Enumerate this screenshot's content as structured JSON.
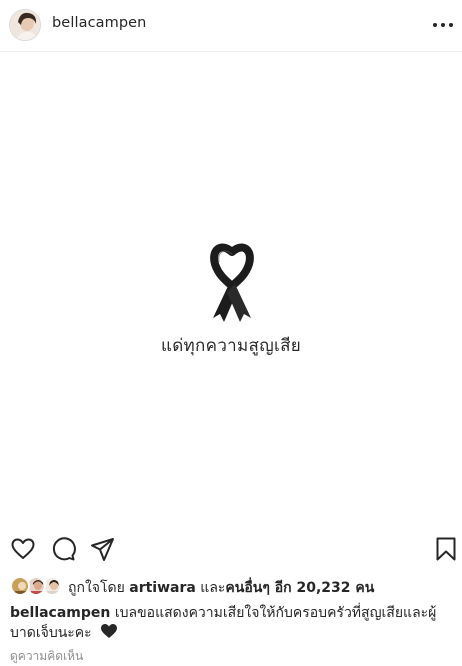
{
  "header": {
    "username": "bellacampen",
    "more_icon": "more-horizontal-icon"
  },
  "post": {
    "ribbon_icon": "black-ribbon-icon",
    "image_text": "แด่ทุกความสูญเสีย"
  },
  "actions": {
    "like_icon": "heart-outline-icon",
    "comment_icon": "comment-bubble-icon",
    "share_icon": "paper-plane-icon",
    "save_icon": "bookmark-icon"
  },
  "likes": {
    "prefix": "ถูกใจโดย ",
    "first_user": "artiwara",
    "joiner": " และ",
    "others_label": "คนอื่นๆ อีก 20,232 คน"
  },
  "caption": {
    "username": "bellacampen",
    "text": "เบลขอแสดงความเสียใจให้กับครอบครัวที่สูญเสียและผู้บาดเจ็บนะคะ",
    "emoji_icon": "black-heart-icon"
  },
  "comments_link": "ดูความคิดเห็น"
}
